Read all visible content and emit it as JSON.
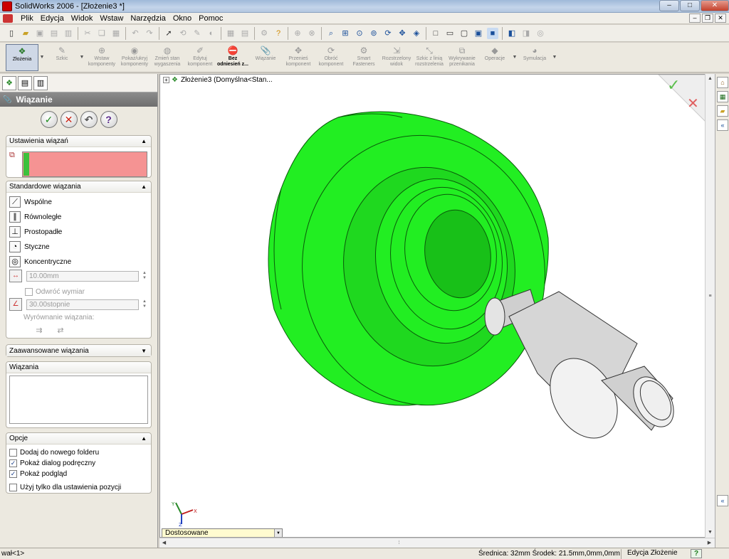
{
  "window": {
    "title": "SolidWorks 2006 - [Złożenie3 *]"
  },
  "menu": [
    "Plik",
    "Edycja",
    "Widok",
    "Wstaw",
    "Narzędzia",
    "Okno",
    "Pomoc"
  ],
  "commands": [
    {
      "label": "Złożenia",
      "state": "active"
    },
    {
      "label": "Szkic",
      "state": "normal"
    },
    {
      "label": "Wstaw\nkomponenty",
      "state": "disabled"
    },
    {
      "label": "Pokaż/ukryj\nkomponenty",
      "state": "disabled"
    },
    {
      "label": "Zmień stan\nwygaszenia",
      "state": "disabled"
    },
    {
      "label": "Edytuj\nkomponent",
      "state": "disabled"
    },
    {
      "label": "Bez\nodniesień z...",
      "state": "bold"
    },
    {
      "label": "Wiązanie",
      "state": "disabled"
    },
    {
      "label": "Przenieś\nkomponent",
      "state": "disabled"
    },
    {
      "label": "Obróć\nkomponent",
      "state": "disabled"
    },
    {
      "label": "Smart\nFasteners",
      "state": "disabled"
    },
    {
      "label": "Rozstrzelony\nwidok",
      "state": "disabled"
    },
    {
      "label": "Szkic z linią\nrozstrzelenia",
      "state": "disabled"
    },
    {
      "label": "Wykrywanie\nprzenikania",
      "state": "disabled"
    },
    {
      "label": "Operacje",
      "state": "disabled"
    },
    {
      "label": "Symulacja",
      "state": "disabled"
    }
  ],
  "panel": {
    "title": "Wiązanie",
    "settings_title": "Ustawienia wiązań",
    "standard_title": "Standardowe wiązania",
    "mates": [
      {
        "label": "Wspólne",
        "icon": "coincident-icon"
      },
      {
        "label": "Równoległe",
        "icon": "parallel-icon"
      },
      {
        "label": "Prostopadłe",
        "icon": "perpendicular-icon"
      },
      {
        "label": "Styczne",
        "icon": "tangent-icon"
      },
      {
        "label": "Koncentryczne",
        "icon": "concentric-icon"
      }
    ],
    "distance_value": "10.00mm",
    "flip_label": "Odwróć wymiar",
    "angle_value": "30.00stopnie",
    "align_label": "Wyrównanie wiązania:",
    "advanced_title": "Zaawansowane wiązania",
    "mates_list_title": "Wiązania",
    "options_title": "Opcje",
    "options": [
      {
        "label": "Dodaj do nowego folderu",
        "checked": false
      },
      {
        "label": "Pokaż dialog podręczny",
        "checked": true
      },
      {
        "label": "Pokaż podgląd",
        "checked": true
      },
      {
        "label": "Użyj tylko dla ustawienia pozycji",
        "checked": false
      }
    ]
  },
  "viewport": {
    "tree_label": "Złożenie3  (Domyślna<Stan...",
    "view_select": "Dostosowane",
    "part_color": "#22ee22",
    "shaft_color": "#d6d6d6"
  },
  "status": {
    "left": "wał<1>",
    "measure": "Średnica: 32mm  Środek: 21.5mm,0mm,0mm",
    "mode": "Edycja Złożenie",
    "help": "?"
  }
}
